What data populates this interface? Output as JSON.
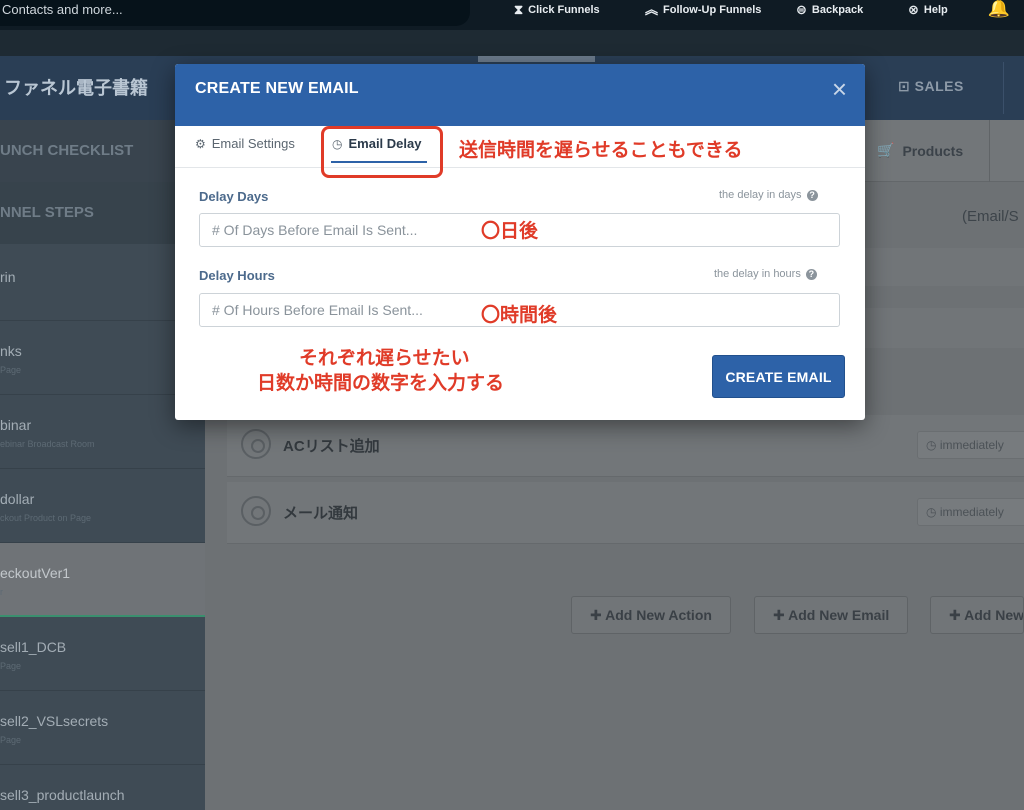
{
  "topnav": {
    "search_text": "Contacts and more...",
    "items": [
      {
        "label": "Click Funnels",
        "icon": "clickfunnels-icon"
      },
      {
        "label": "Follow-Up Funnels",
        "icon": "chevrons-up-icon"
      },
      {
        "label": "Backpack",
        "icon": "backpack-icon"
      },
      {
        "label": "Help",
        "icon": "lifebuoy-icon"
      }
    ]
  },
  "header": {
    "funnel_title": "ファネル電子書籍",
    "sales_tab": "SALES"
  },
  "sidebar": {
    "section_checklist": "UNCH CHECKLIST",
    "section_steps": "NNEL STEPS",
    "steps": [
      {
        "name": "rin",
        "sub": ""
      },
      {
        "name": "nks",
        "sub": "Page"
      },
      {
        "name": "binar",
        "sub": "ebinar Broadcast Room"
      },
      {
        "name": "dollar",
        "sub": "ckout Product on Page"
      },
      {
        "name": "eckoutVer1",
        "sub": "r"
      },
      {
        "name": "sell1_DCB",
        "sub": "Page"
      },
      {
        "name": "sell2_VSLsecrets",
        "sub": "Page"
      },
      {
        "name": "sell3_productlaunch",
        "sub": ""
      }
    ]
  },
  "main": {
    "products_tab": "Products",
    "email_s": "(Email/S",
    "actions": [
      {
        "label": "ACリスト追加",
        "timing": "immediately"
      },
      {
        "label": "メール通知",
        "timing": "immediately"
      }
    ],
    "buttons": [
      "Add New Action",
      "Add New Email",
      "Add New"
    ]
  },
  "modal": {
    "title": "CREATE NEW EMAIL",
    "close": "×",
    "tabs": [
      {
        "label": "Email Settings",
        "icon": "gears-icon"
      },
      {
        "label": "Email Delay",
        "icon": "clock-icon"
      }
    ],
    "delay_days": {
      "label": "Delay Days",
      "help": "the delay in days",
      "placeholder": "# Of Days Before Email Is Sent..."
    },
    "delay_hours": {
      "label": "Delay Hours",
      "help": "the delay in hours",
      "placeholder": "# Of Hours Before Email Is Sent..."
    },
    "create_button": "CREATE EMAIL"
  },
  "annotations": {
    "tab_note": "送信時間を遅らせることもできる",
    "days_note": "〇日後",
    "hours_note": "〇時間後",
    "instruction_line1": "それぞれ遅らせたい",
    "instruction_line2": "日数か時間の数字を入力する"
  },
  "colors": {
    "modal_header": "#2d62a8",
    "annotation_red": "#e03b28",
    "primary_button": "#2d62a8"
  }
}
